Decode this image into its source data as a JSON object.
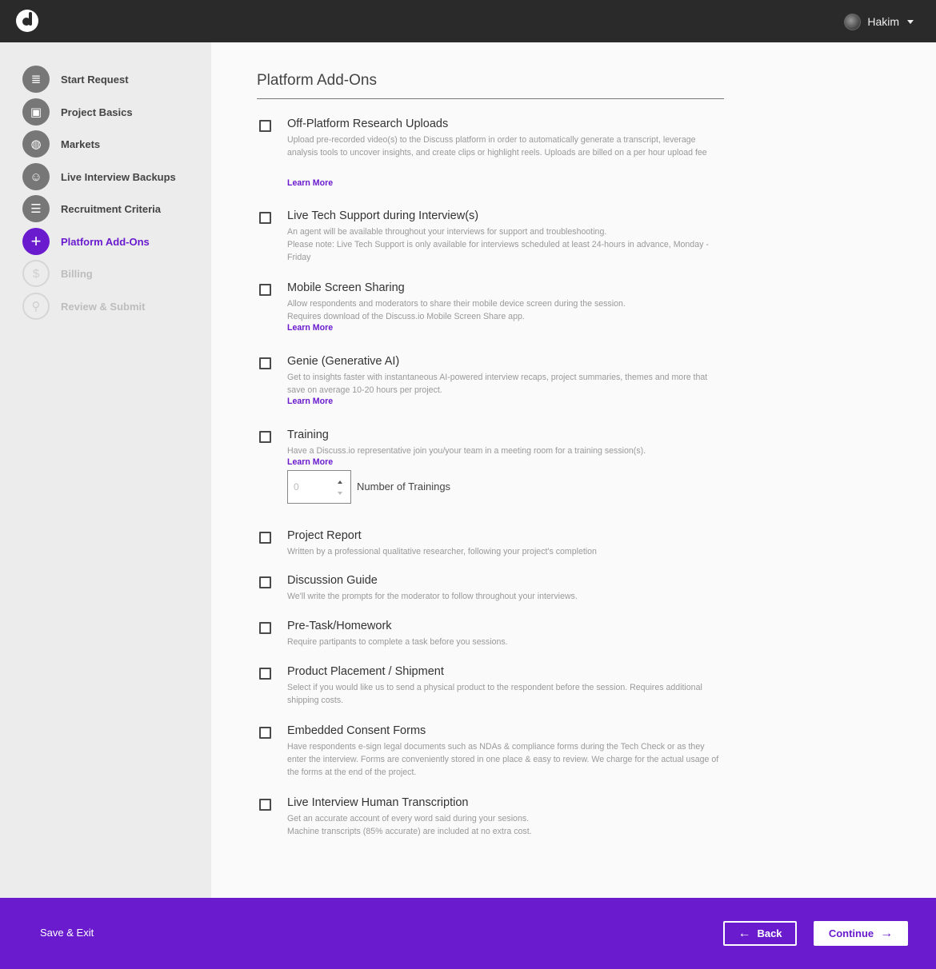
{
  "header": {
    "user_name": "Hakim"
  },
  "sidebar": {
    "steps": [
      {
        "label": "Start Request",
        "icon": "clipboard-icon",
        "glyph": "≣",
        "state": "done"
      },
      {
        "label": "Project Basics",
        "icon": "calendar-icon",
        "glyph": "▣",
        "state": "done"
      },
      {
        "label": "Markets",
        "icon": "globe-icon",
        "glyph": "◍",
        "state": "done"
      },
      {
        "label": "Live Interview Backups",
        "icon": "person-icon",
        "glyph": "☺",
        "state": "done"
      },
      {
        "label": "Recruitment Criteria",
        "icon": "filter-icon",
        "glyph": "☰",
        "state": "done"
      },
      {
        "label": "Platform Add-Ons",
        "icon": "plus-icon",
        "glyph": "+",
        "state": "active"
      },
      {
        "label": "Billing",
        "icon": "dollar-icon",
        "glyph": "$",
        "state": "disabled"
      },
      {
        "label": "Review & Submit",
        "icon": "magnifier-icon",
        "glyph": "⚲",
        "state": "disabled"
      }
    ]
  },
  "main": {
    "title": "Platform Add-Ons",
    "addons": [
      {
        "name": "Off-Platform Research Uploads",
        "desc": "Upload pre-recorded video(s) to the Discuss platform in order to automatically generate a transcript, leverage analysis tools to uncover insights, and create clips or highlight reels. Uploads are billed on a per hour upload fee",
        "learn": "Learn More",
        "checked": false
      },
      {
        "name": "Live Tech Support during Interview(s)",
        "desc": "An agent will be available throughout your interviews for support and troubleshooting.\nPlease note: Live Tech Support is only available for interviews scheduled at least 24-hours in advance, Monday - Friday",
        "checked": false
      },
      {
        "name": "Mobile Screen Sharing",
        "desc": "Allow respondents and moderators to share their mobile device screen during the session.\nRequires download of the Discuss.io Mobile Screen Share app.",
        "learn": "Learn More",
        "checked": false
      },
      {
        "name": "Genie (Generative AI)",
        "desc": "Get to insights faster with instantaneous AI-powered interview recaps, project summaries, themes and more that save on average 10-20 hours per project.",
        "learn": "Learn More",
        "checked": false
      },
      {
        "name": "Training",
        "desc": "Have a Discuss.io representative join you/your team in a meeting room for a training session(s).",
        "learn": "Learn More",
        "checked": false,
        "quantity_value": "0",
        "quantity_label": "Number of Trainings"
      },
      {
        "name": "Project Report",
        "desc": "Written by a professional qualitative researcher, following your project's completion",
        "checked": false
      },
      {
        "name": "Discussion Guide",
        "desc": "We'll write the prompts for the moderator to follow throughout your interviews.",
        "checked": false
      },
      {
        "name": "Pre-Task/Homework",
        "desc": "Require partipants to complete a task before you sessions.",
        "checked": false
      },
      {
        "name": "Product Placement / Shipment",
        "desc": "Select if you would like us to send a physical product to the respondent before the session. Requires additional shipping costs.",
        "checked": false
      },
      {
        "name": "Embedded Consent Forms",
        "desc": "Have respondents e-sign legal documents such as NDAs & compliance forms during the Tech Check or as they enter the interview. Forms are conveniently stored in one place & easy to review. We charge for the actual usage of the forms at the end of the project.",
        "checked": false
      },
      {
        "name": "Live Interview Human Transcription",
        "desc": "Get an accurate account of every word said during your sesions.\nMachine transcripts (85% accurate) are included at no extra cost.",
        "checked": false
      }
    ]
  },
  "footer": {
    "save_exit": "Save & Exit",
    "back_label": "Back",
    "continue_label": "Continue"
  },
  "colors": {
    "accent": "#6a1bce",
    "topbar": "#2a2a2a",
    "sidebar": "#ececec"
  }
}
